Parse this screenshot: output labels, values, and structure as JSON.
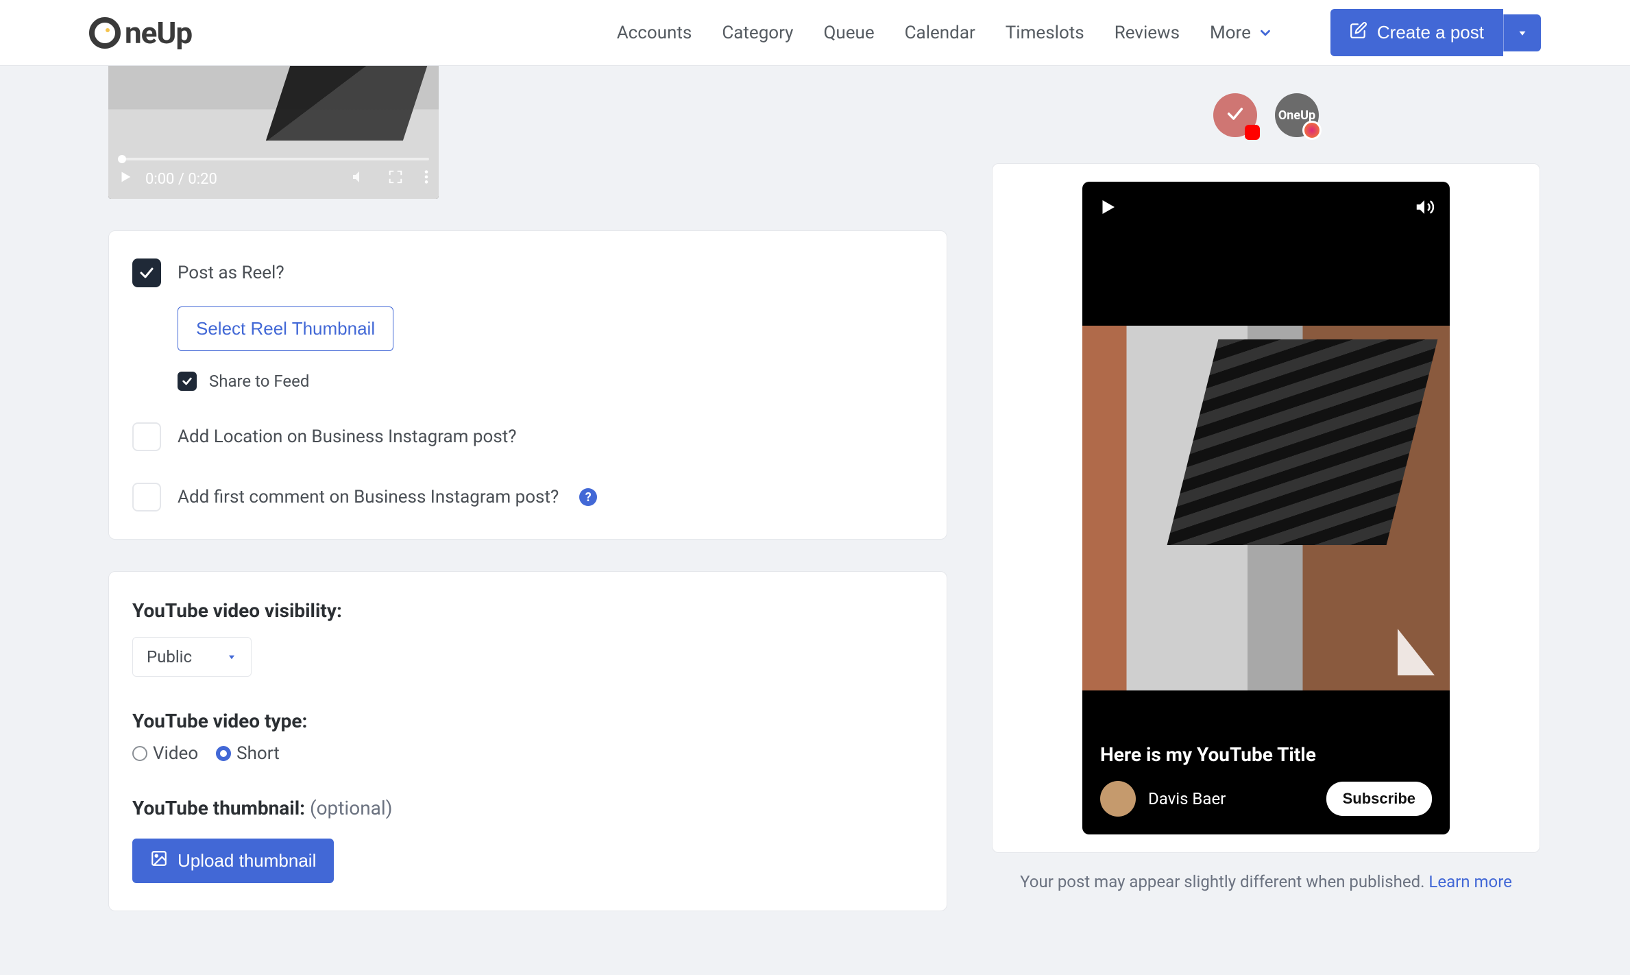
{
  "nav": {
    "logo_text": "neUp",
    "items": [
      "Accounts",
      "Category",
      "Queue",
      "Calendar",
      "Timeslots",
      "Reviews",
      "More"
    ],
    "create_label": "Create a post"
  },
  "video": {
    "time": "0:00 / 0:20"
  },
  "reel": {
    "post_as_reel_label": "Post as Reel?",
    "select_thumb_label": "Select Reel Thumbnail",
    "share_feed_label": "Share to Feed",
    "add_location_label": "Add Location on Business Instagram post?",
    "add_first_comment_label": "Add first comment on Business Instagram post?"
  },
  "youtube": {
    "visibility_label": "YouTube video visibility:",
    "visibility_value": "Public",
    "type_label": "YouTube video type:",
    "type_options": {
      "video": "Video",
      "short": "Short"
    },
    "type_selected": "short",
    "thumb_label": "YouTube thumbnail:",
    "thumb_optional": "(optional)",
    "upload_label": "Upload thumbnail"
  },
  "preview": {
    "avatar_ig_text": "OneUp",
    "short_title": "Here is my YouTube Title",
    "author": "Davis Baer",
    "subscribe": "Subscribe"
  },
  "disclaimer": {
    "text": "Your post may appear slightly different when published. ",
    "link": "Learn more"
  }
}
